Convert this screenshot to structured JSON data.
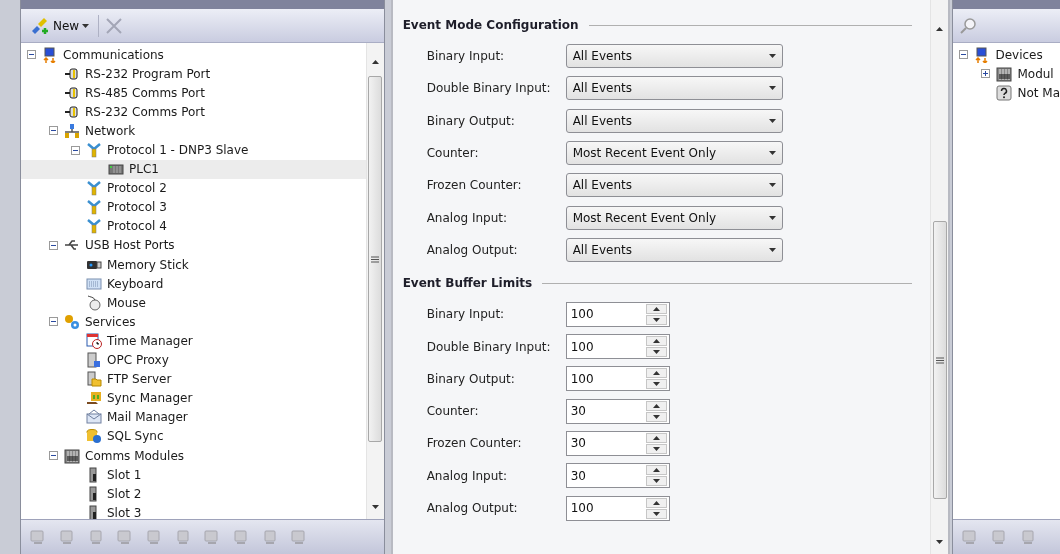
{
  "left_toolbar": {
    "new_label": "New",
    "delete_disabled": true
  },
  "tree": [
    {
      "label": "Communications",
      "kind": "comms",
      "selected": false,
      "expanded": true,
      "children": [
        {
          "label": "RS-232 Program Port",
          "kind": "port",
          "selected": false
        },
        {
          "label": "RS-485 Comms Port",
          "kind": "port",
          "selected": false
        },
        {
          "label": "RS-232 Comms Port",
          "kind": "port",
          "selected": false
        },
        {
          "label": "Network",
          "kind": "network",
          "selected": false,
          "expanded": true,
          "children": [
            {
              "label": "Protocol 1 - DNP3 Slave",
              "kind": "protocol",
              "selected": false,
              "expanded": true,
              "children": [
                {
                  "label": "PLC1",
                  "kind": "plc",
                  "selected": true
                }
              ]
            },
            {
              "label": "Protocol 2",
              "kind": "protocol",
              "selected": false
            },
            {
              "label": "Protocol 3",
              "kind": "protocol",
              "selected": false
            },
            {
              "label": "Protocol 4",
              "kind": "protocol",
              "selected": false
            }
          ]
        },
        {
          "label": "USB Host Ports",
          "kind": "usb",
          "selected": false,
          "expanded": true,
          "children": [
            {
              "label": "Memory Stick",
              "kind": "stick",
              "selected": false
            },
            {
              "label": "Keyboard",
              "kind": "keyboard",
              "selected": false
            },
            {
              "label": "Mouse",
              "kind": "mouse",
              "selected": false
            }
          ]
        },
        {
          "label": "Services",
          "kind": "services",
          "selected": false,
          "expanded": true,
          "children": [
            {
              "label": "Time Manager",
              "kind": "clock",
              "selected": false
            },
            {
              "label": "OPC Proxy",
              "kind": "server",
              "selected": false
            },
            {
              "label": "FTP Server",
              "kind": "folder",
              "selected": false
            },
            {
              "label": "Sync Manager",
              "kind": "sync",
              "selected": false
            },
            {
              "label": "Mail Manager",
              "kind": "mail",
              "selected": false
            },
            {
              "label": "SQL Sync",
              "kind": "database",
              "selected": false
            }
          ]
        },
        {
          "label": "Comms Modules",
          "kind": "rack",
          "selected": false,
          "expanded": true,
          "children": [
            {
              "label": "Slot 1",
              "kind": "slot",
              "selected": false
            },
            {
              "label": "Slot 2",
              "kind": "slot",
              "selected": false
            },
            {
              "label": "Slot 3",
              "kind": "slot",
              "selected": false
            }
          ]
        }
      ]
    }
  ],
  "event_mode": {
    "title": "Event Mode Configuration",
    "rows": [
      {
        "label": "Binary Input:",
        "value": "All Events"
      },
      {
        "label": "Double Binary Input:",
        "value": "All Events"
      },
      {
        "label": "Binary Output:",
        "value": "All Events"
      },
      {
        "label": "Counter:",
        "value": "Most Recent Event Only"
      },
      {
        "label": "Frozen Counter:",
        "value": "All Events"
      },
      {
        "label": "Analog Input:",
        "value": "Most Recent Event Only"
      },
      {
        "label": "Analog Output:",
        "value": "All Events"
      }
    ]
  },
  "buffer_limits": {
    "title": "Event Buffer Limits",
    "rows": [
      {
        "label": "Binary Input:",
        "value": "100"
      },
      {
        "label": "Double Binary Input:",
        "value": "100"
      },
      {
        "label": "Binary Output:",
        "value": "100"
      },
      {
        "label": "Counter:",
        "value": "30"
      },
      {
        "label": "Frozen Counter:",
        "value": "30"
      },
      {
        "label": "Analog Input:",
        "value": "30"
      },
      {
        "label": "Analog Output:",
        "value": "100"
      }
    ]
  },
  "device_tree": [
    {
      "label": "Devices",
      "kind": "comms",
      "selected": false,
      "expanded": true,
      "children": [
        {
          "label": "Modul",
          "kind": "rack",
          "selected": false,
          "expanded": false
        },
        {
          "label": "Not Ma",
          "kind": "unknown",
          "selected": false
        }
      ]
    }
  ]
}
